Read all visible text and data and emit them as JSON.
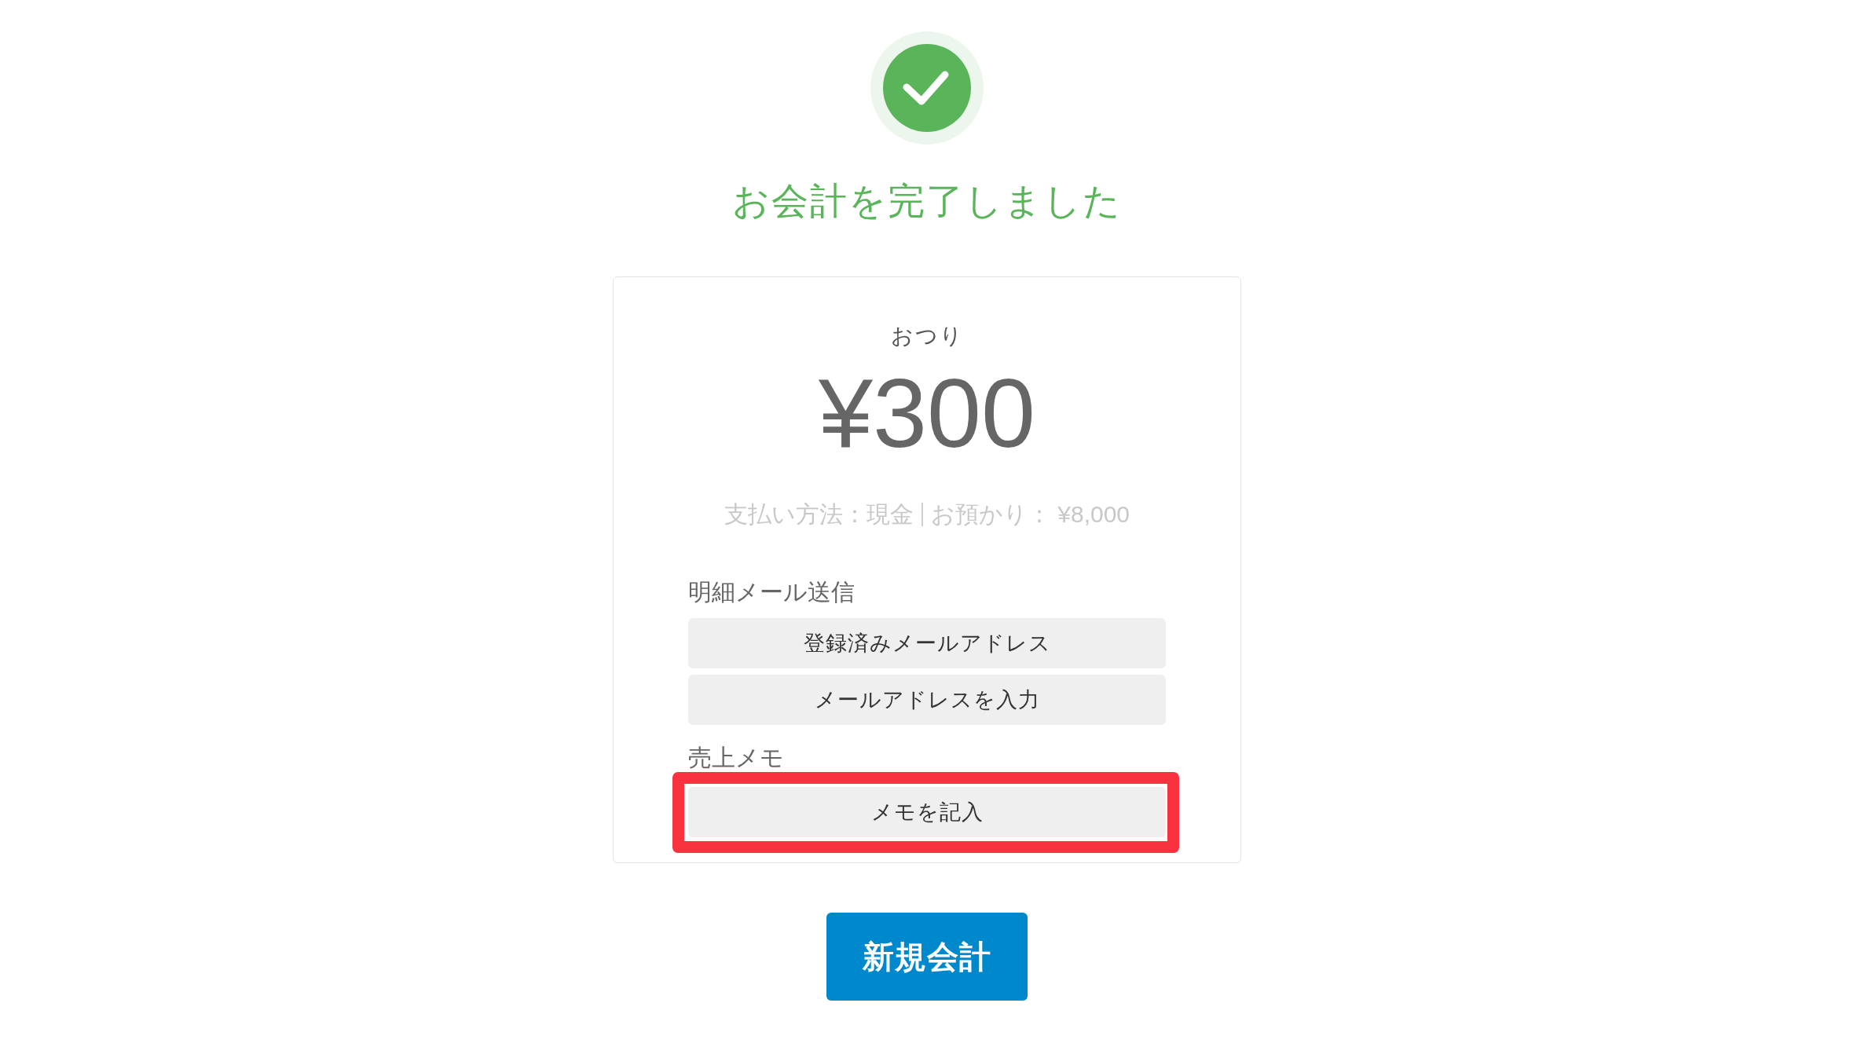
{
  "status": {
    "title": "お会計を完了しました"
  },
  "receipt": {
    "change_label": "おつり",
    "change_amount": "¥300",
    "details": [
      "支払い方法：現金",
      "お預かり： ¥8,000"
    ]
  },
  "email_section": {
    "heading": "明細メール送信",
    "buttons": [
      "登録済みメールアドレス",
      "メールアドレスを入力"
    ]
  },
  "memo_section": {
    "heading": "売上メモ",
    "button": {
      "label": "メモを記入",
      "highlighted": true
    }
  },
  "new_sale_button": "新規会計"
}
